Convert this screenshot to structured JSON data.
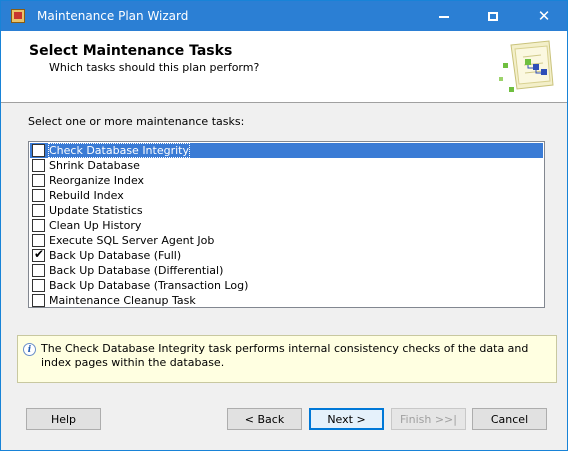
{
  "window": {
    "title": "Maintenance Plan Wizard"
  },
  "header": {
    "title": "Select Maintenance Tasks",
    "subtitle": "Which tasks should this plan perform?"
  },
  "prompt": "Select one or more maintenance tasks:",
  "tasks": [
    {
      "label": "Check Database Integrity",
      "checked": false,
      "selected": true
    },
    {
      "label": "Shrink Database",
      "checked": false,
      "selected": false
    },
    {
      "label": "Reorganize Index",
      "checked": false,
      "selected": false
    },
    {
      "label": "Rebuild Index",
      "checked": false,
      "selected": false
    },
    {
      "label": "Update Statistics",
      "checked": false,
      "selected": false
    },
    {
      "label": "Clean Up History",
      "checked": false,
      "selected": false
    },
    {
      "label": "Execute SQL Server Agent Job",
      "checked": false,
      "selected": false
    },
    {
      "label": "Back Up Database (Full)",
      "checked": true,
      "selected": false
    },
    {
      "label": "Back Up Database (Differential)",
      "checked": false,
      "selected": false
    },
    {
      "label": "Back Up Database (Transaction Log)",
      "checked": false,
      "selected": false
    },
    {
      "label": "Maintenance Cleanup Task",
      "checked": false,
      "selected": false
    }
  ],
  "info": {
    "text": "The Check Database Integrity task performs internal consistency checks of the data and index pages within the database."
  },
  "buttons": {
    "help": "Help",
    "back": "< Back",
    "next": "Next >",
    "finish": "Finish >>|",
    "cancel": "Cancel"
  },
  "colors": {
    "titlebar": "#2b7fd4",
    "selection": "#3a7bd5",
    "info_background": "#ffffe1"
  }
}
